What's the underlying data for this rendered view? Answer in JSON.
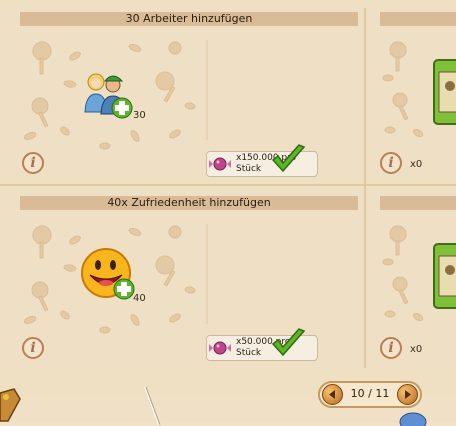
{
  "cards": [
    {
      "title": "30 Arbeiter hinzufügen",
      "bonus_amount": "30",
      "price_text": "x150.000 pro",
      "price_unit": "Stück",
      "icon": "workers-icon"
    },
    {
      "title": "40x Zufriedenheit hinzufügen",
      "bonus_amount": "40",
      "price_text": "x50.000 pro",
      "price_unit": "Stück",
      "icon": "smiley-icon"
    }
  ],
  "side_cards": [
    {
      "count": "x0",
      "icon": "green-package-icon"
    },
    {
      "count": "x0",
      "icon": "green-package-icon"
    }
  ],
  "pagination": {
    "label": "10 / 11",
    "current": 10,
    "total": 11
  },
  "colors": {
    "background": "#efdfc3",
    "title_bar": "#d9bb97",
    "check_green": "#5fb42c",
    "info_icon": "#b06d43"
  }
}
